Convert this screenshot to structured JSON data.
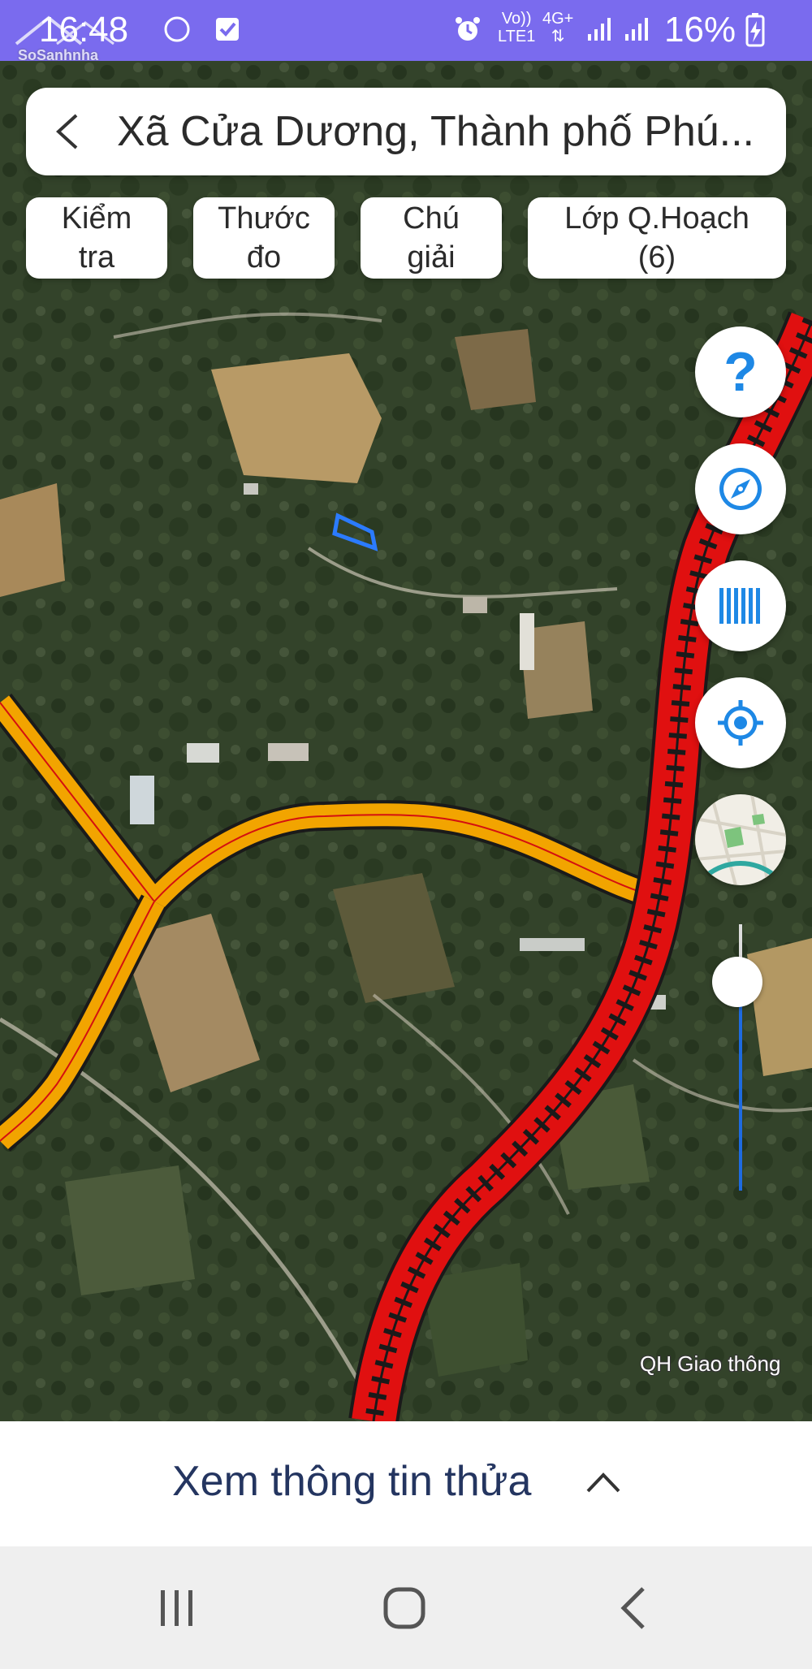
{
  "status_bar": {
    "time": "16:48",
    "carrier_line1": "Vo))",
    "carrier_line2": "LTE1",
    "network": "4G+",
    "battery": "16%"
  },
  "watermark": {
    "text": "SoSanhnha"
  },
  "search": {
    "title": "Xã Cửa Dương, Thành phố Phú..."
  },
  "toolbar": {
    "check_label": "Kiểm\ntra",
    "ruler_label": "Thước\nđo",
    "legend_label": "Chú\ngiải",
    "layers_label": "Lớp Q.Hoạch\n(6)"
  },
  "map": {
    "overlay_label": "QH Giao thông",
    "zoom_level_fraction": 0.88
  },
  "bottom_panel": {
    "label": "Xem thông tin thửa"
  },
  "icons": {
    "help": "question-icon",
    "compass": "compass-icon",
    "barcode": "barcode-icon",
    "locate": "my-location-icon",
    "layer": "map-layer-icon"
  },
  "colors": {
    "status_bar": "#7a6bee",
    "accent": "#1e88e5",
    "planned_road_red": "#e01010",
    "planned_road_orange": "#f2a400"
  }
}
